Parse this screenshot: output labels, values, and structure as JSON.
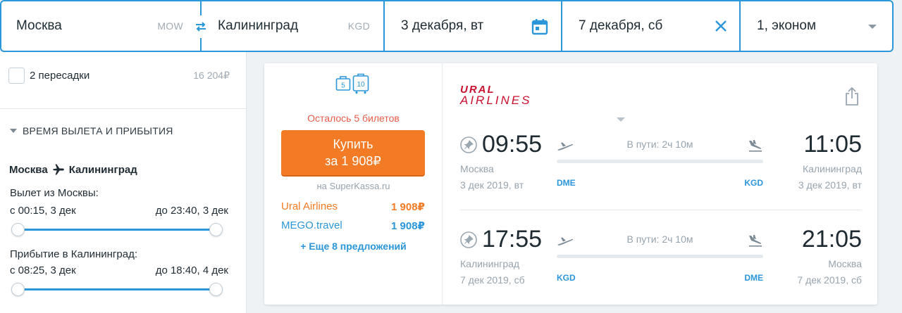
{
  "search": {
    "from_city": "Москва",
    "from_code": "MOW",
    "to_city": "Калининград",
    "to_code": "KGD",
    "depart_date": "3 декабря, вт",
    "return_date": "7 декабря, сб",
    "passengers": "1, эконом"
  },
  "filters": {
    "stops_option_label": "2 пересадки",
    "stops_option_price": "16 204₽",
    "section_title": "ВРЕМЯ ВЫЛЕТА И ПРИБЫТИЯ",
    "route_from": "Москва",
    "route_to": "Калининград",
    "departure_label": "Вылет из Москвы:",
    "departure_from": "с 00:15, 3 дек",
    "departure_to": "до 23:40, 3 дек",
    "arrival_label": "Прибытие в Калининград:",
    "arrival_from": "с 08:25, 3 дек",
    "arrival_to": "до 18:40, 4 дек"
  },
  "ticket": {
    "baggage_handbag_kg": "5",
    "baggage_luggage_kg": "10",
    "tickets_left": "Осталось 5 билетов",
    "buy_label": "Купить",
    "buy_price": "за 1 908₽",
    "seller": "на SuperKassa.ru",
    "offers": [
      {
        "name": "Ural Airlines",
        "price": "1 908₽"
      },
      {
        "name": "MEGO.travel",
        "price": "1 908₽"
      }
    ],
    "more_offers": "+ Еще 8 предложений",
    "airline_logo_line1": "URAL",
    "airline_logo_line2": "AIRLINES",
    "segments": [
      {
        "depart_time": "09:55",
        "depart_city": "Москва",
        "depart_date": "3 дек 2019, вт",
        "depart_airport": "DME",
        "duration": "В пути: 2ч 10м",
        "arrive_time": "11:05",
        "arrive_city": "Калининград",
        "arrive_date": "3 дек 2019, вт",
        "arrive_airport": "KGD"
      },
      {
        "depart_time": "17:55",
        "depart_city": "Калининград",
        "depart_date": "7 дек 2019, сб",
        "depart_airport": "KGD",
        "duration": "В пути: 2ч 10м",
        "arrive_time": "21:05",
        "arrive_city": "Москва",
        "arrive_date": "7 дек 2019, сб",
        "arrive_airport": "DME"
      }
    ]
  },
  "colors": {
    "brand_blue": "#2b96d8",
    "buy_orange": "#f37b25",
    "warning_red": "#e85c4a",
    "airline_red": "#c8102e"
  },
  "icons": [
    "swap-icon",
    "calendar-icon",
    "clear-icon",
    "dropdown-caret-icon",
    "airplane-icon",
    "handbag-icon",
    "luggage-icon",
    "share-icon",
    "pin-icon",
    "takeoff-icon",
    "landing-icon",
    "expand-caret-icon"
  ]
}
